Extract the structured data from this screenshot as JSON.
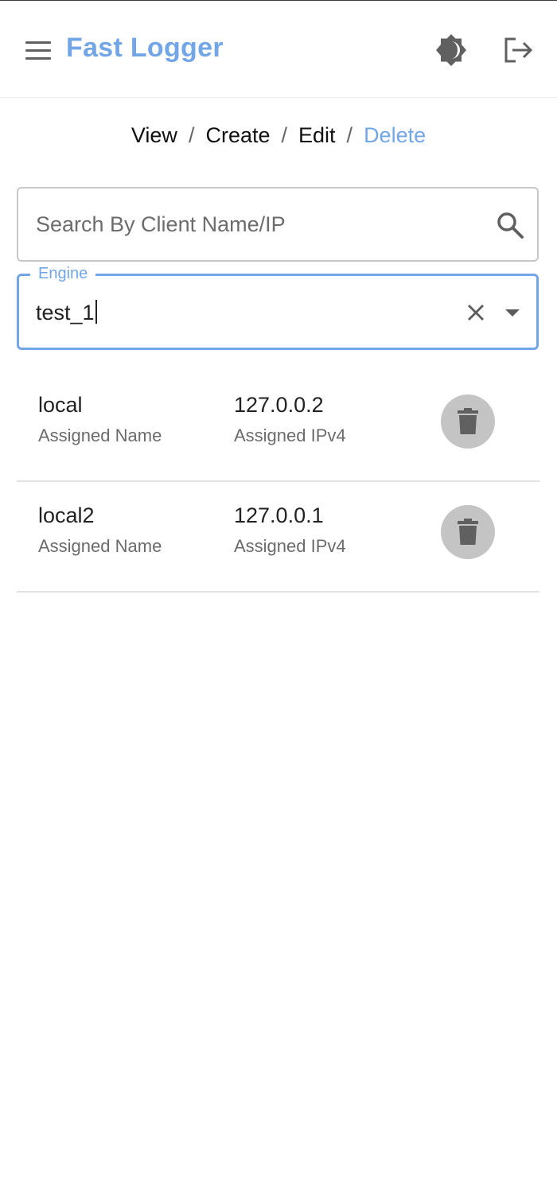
{
  "appbar": {
    "title": "Fast Logger",
    "menu_icon": "menu-icon",
    "theme_icon": "brightness-icon",
    "logout_icon": "logout-icon"
  },
  "breadcrumb": {
    "items": [
      "View",
      "Create",
      "Edit",
      "Delete"
    ],
    "active": "Delete",
    "separator": "/"
  },
  "search": {
    "placeholder": "Search By Client Name/IP",
    "value": "",
    "icon": "search-icon"
  },
  "engine": {
    "label": "Engine",
    "value": "test_1",
    "clear_icon": "close-icon",
    "dropdown_icon": "caret-down-icon"
  },
  "clients": [
    {
      "name": "local",
      "name_label": "Assigned Name",
      "ip": "127.0.0.2",
      "ip_label": "Assigned IPv4",
      "action_icon": "trash-icon"
    },
    {
      "name": "local2",
      "name_label": "Assigned Name",
      "ip": "127.0.0.1",
      "ip_label": "Assigned IPv4",
      "action_icon": "trash-icon"
    }
  ],
  "colors": {
    "accent": "#73a6e7",
    "icon": "#606060",
    "delete_button_bg": "#c4c4c4"
  }
}
